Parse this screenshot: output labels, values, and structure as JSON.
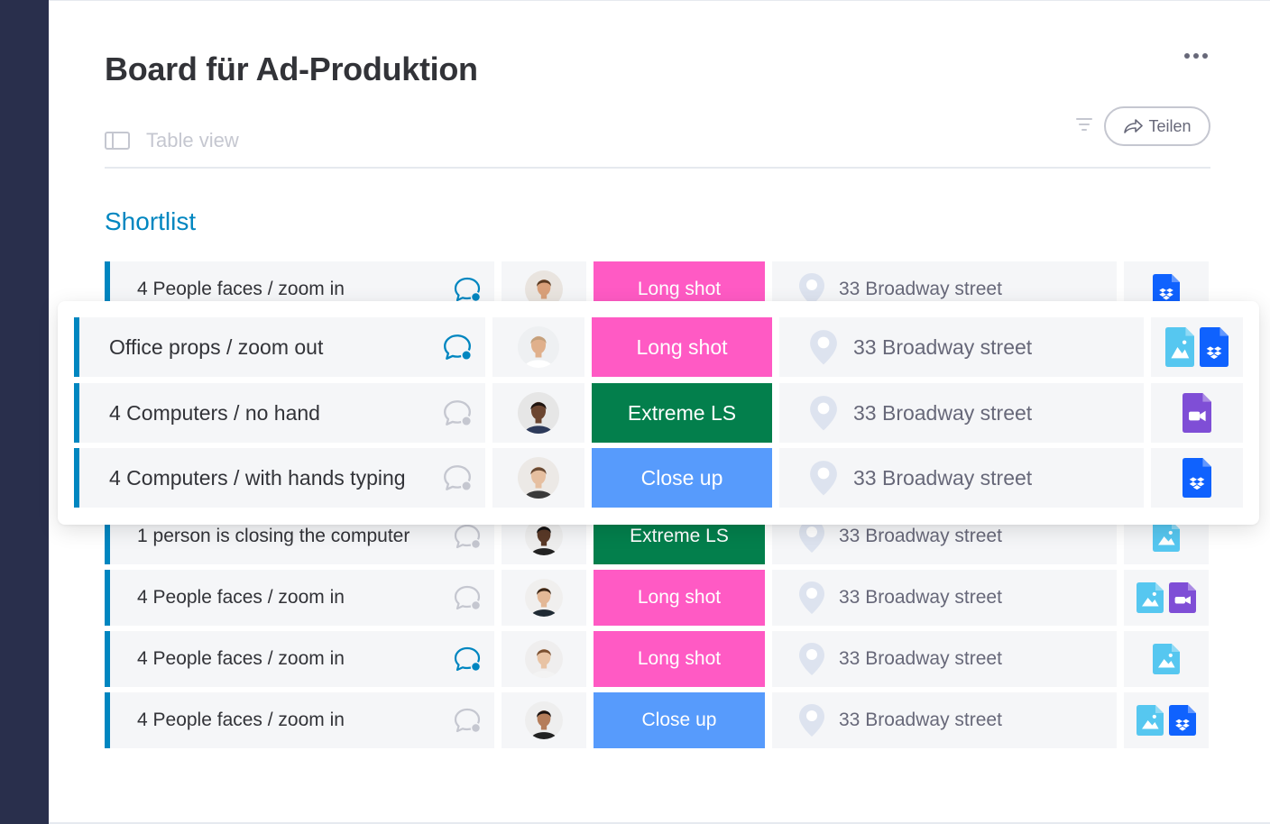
{
  "board": {
    "title": "Board für Ad-Produktion",
    "view_label": "Table view",
    "share_label": "Teilen",
    "group_title": "Shortlist"
  },
  "colors": {
    "group_accent": "#0086c0",
    "status_long_shot": "#ff5ac4",
    "status_extreme_ls": "#037f4c",
    "status_close_up": "#579bfc",
    "chat_active": "#0086c0",
    "chat_inactive": "#c5c7d0"
  },
  "rows_back": [
    {
      "name": "4 People faces / zoom in",
      "chat_active": true,
      "status": "Long shot",
      "location": "33 Broadway street",
      "files": [
        "dropbox"
      ]
    },
    {
      "name": "1 person is closing the computer",
      "chat_active": false,
      "status": "Extreme LS",
      "location": "33 Broadway street",
      "files": [
        "image"
      ]
    },
    {
      "name": "4 People faces / zoom in",
      "chat_active": false,
      "status": "Long shot",
      "location": "33 Broadway street",
      "files": [
        "image",
        "video"
      ]
    },
    {
      "name": "4 People faces / zoom in",
      "chat_active": true,
      "status": "Long shot",
      "location": "33 Broadway street",
      "files": [
        "image"
      ]
    },
    {
      "name": "4 People faces / zoom in",
      "chat_active": false,
      "status": "Close up",
      "location": "33 Broadway street",
      "files": [
        "image",
        "dropbox"
      ]
    }
  ],
  "rows_front": [
    {
      "name": "Office props / zoom out",
      "chat_active": true,
      "status": "Long shot",
      "location": "33 Broadway street",
      "files": [
        "image",
        "dropbox"
      ]
    },
    {
      "name": "4 Computers / no hand",
      "chat_active": false,
      "status": "Extreme LS",
      "location": "33 Broadway street",
      "files": [
        "video"
      ]
    },
    {
      "name": "4 Computers / with hands typing",
      "chat_active": false,
      "status": "Close up",
      "location": "33 Broadway street",
      "files": [
        "dropbox"
      ]
    }
  ]
}
